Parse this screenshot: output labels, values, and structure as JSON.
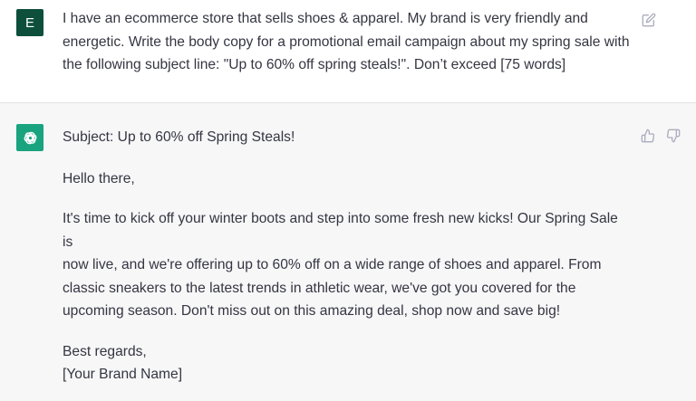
{
  "user_message": {
    "avatar_letter": "E",
    "avatar_color": "#0d4f3b",
    "lines": [
      "I have an ecommerce store that sells shoes & apparel. My brand is very friendly and",
      "energetic. Write the body copy for a promotional email campaign about my spring sale with",
      "the following subject line: \"Up to 60% off spring steals!\". Don’t exceed [75 words]"
    ],
    "edit_icon": "edit-pencil-icon"
  },
  "assistant_message": {
    "avatar_icon": "openai-logo-icon",
    "avatar_color": "#19a37f",
    "subject": "Subject: Up to 60% off Spring Steals!",
    "greeting": "Hello there,",
    "body_lines": [
      "It's time to kick off your winter boots and step into some fresh new kicks! Our Spring Sale is",
      "now live, and we're offering up to 60% off on a wide range of shoes and apparel. From",
      "classic sneakers to the latest trends in athletic wear, we've got you covered for the",
      "upcoming season. Don't miss out on this amazing deal, shop now and save big!"
    ],
    "signoff": "Best regards,",
    "signature": "[Your Brand Name]",
    "thumbs_up_icon": "thumbs-up-icon",
    "thumbs_down_icon": "thumbs-down-icon"
  }
}
